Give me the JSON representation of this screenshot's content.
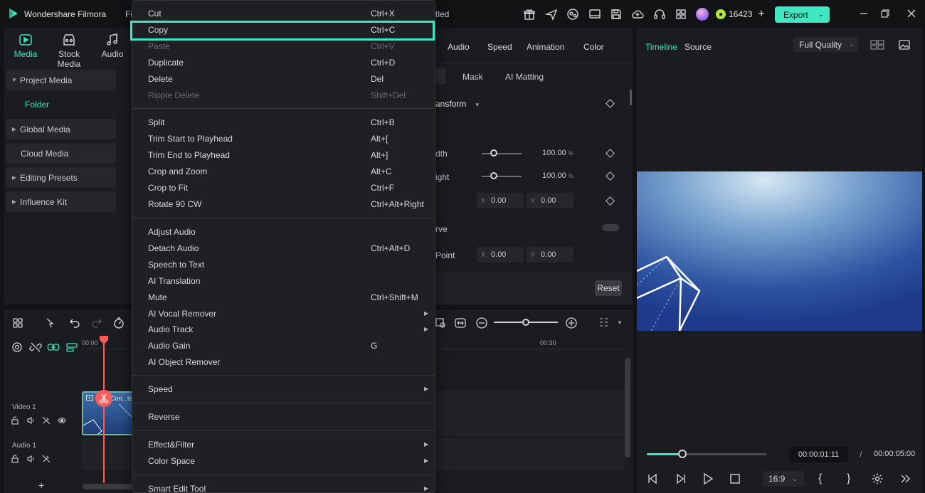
{
  "app": {
    "name": "Wondershare Filmora",
    "menu_partial": "Fi",
    "project_name_partial": "tled"
  },
  "colors": {
    "accent": "#3ee6c1",
    "playhead": "#ff5a5a",
    "background": "#121315",
    "panel": "#1b1c1f"
  },
  "titlebar": {
    "icons": [
      "gift-icon",
      "send-icon",
      "community-icon",
      "screen-icon",
      "save-icon",
      "cloud-upload-icon",
      "headset-icon",
      "apps-grid-icon"
    ],
    "credits": "16423",
    "export_label": "Export",
    "window_controls": [
      "minimize-icon",
      "restore-icon",
      "close-icon"
    ]
  },
  "media_panel": {
    "tabs": [
      {
        "label": "Media",
        "icon": "media-icon",
        "active": true
      },
      {
        "label": "Stock Media",
        "icon": "stock-media-icon",
        "active": false
      },
      {
        "label": "Audio",
        "icon": "music-note-icon",
        "active": false
      }
    ],
    "nav": [
      {
        "label": "Project Media",
        "expanded": true
      },
      {
        "label": "Folder",
        "child": true
      },
      {
        "label": "Global Media",
        "expanded": false
      },
      {
        "label": "Cloud Media"
      },
      {
        "label": "Editing Presets",
        "expanded": false
      },
      {
        "label": "Influence Kit",
        "expanded": false
      }
    ]
  },
  "props_panel": {
    "tabs": [
      "Audio",
      "Speed",
      "Animation",
      "Color"
    ],
    "subtabs": [
      "Mask",
      "AI Matting"
    ],
    "section": "ansform",
    "rows": {
      "width": {
        "label": "dth",
        "value": "100.00",
        "unit": "%",
        "fraction": 0.3
      },
      "height": {
        "label": "ight",
        "value": "100.00",
        "unit": "%",
        "fraction": 0.3
      },
      "position": {
        "x_label": "X",
        "x": "0.00",
        "y_label": "Y",
        "y": "0.00"
      },
      "curve": {
        "label": "rve"
      },
      "anchor": {
        "label": "Point",
        "x_label": "X",
        "x": "0.00",
        "y_label": "Y",
        "y": "0.00"
      }
    },
    "reset_label": "Reset"
  },
  "preview": {
    "tabs": [
      {
        "label": "Timeline",
        "active": true
      },
      {
        "label": "Source",
        "active": false
      }
    ],
    "quality": "Full Quality",
    "progress": 0.3,
    "current_time": "00:00:01:11",
    "separator": "/",
    "total_time": "00:00:05:00",
    "aspect_ratio": "16:9"
  },
  "timeline": {
    "ruler": [
      "00:00",
      "00:30"
    ],
    "tracks": [
      {
        "name": "Video 1"
      },
      {
        "name": "Audio 1"
      }
    ],
    "clip_title": "Con...te",
    "add_track": "+"
  },
  "context_menu": {
    "groups": [
      [
        {
          "label": "Cut",
          "shortcut": "Ctrl+X"
        },
        {
          "label": "Copy",
          "shortcut": "Ctrl+C",
          "highlighted": true
        },
        {
          "label": "Paste",
          "shortcut": "Ctrl+V",
          "disabled": true
        },
        {
          "label": "Duplicate",
          "shortcut": "Ctrl+D"
        },
        {
          "label": "Delete",
          "shortcut": "Del"
        },
        {
          "label": "Ripple Delete",
          "shortcut": "Shift+Del",
          "disabled": true
        }
      ],
      [
        {
          "label": "Split",
          "shortcut": "Ctrl+B"
        },
        {
          "label": "Trim Start to Playhead",
          "shortcut": "Alt+["
        },
        {
          "label": "Trim End to Playhead",
          "shortcut": "Alt+]"
        },
        {
          "label": "Crop and Zoom",
          "shortcut": "Alt+C"
        },
        {
          "label": "Crop to Fit",
          "shortcut": "Ctrl+F"
        },
        {
          "label": "Rotate 90 CW",
          "shortcut": "Ctrl+Alt+Right"
        }
      ],
      [
        {
          "label": "Adjust Audio",
          "shortcut": ""
        },
        {
          "label": "Detach Audio",
          "shortcut": "Ctrl+Alt+D"
        },
        {
          "label": "Speech to Text",
          "shortcut": ""
        },
        {
          "label": "AI Translation",
          "shortcut": ""
        },
        {
          "label": "Mute",
          "shortcut": "Ctrl+Shift+M"
        },
        {
          "label": "AI Vocal Remover",
          "shortcut": "",
          "submenu": true
        },
        {
          "label": "Audio Track",
          "shortcut": "",
          "submenu": true
        },
        {
          "label": "Audio Gain",
          "shortcut": "G"
        },
        {
          "label": "AI Object Remover",
          "shortcut": ""
        }
      ],
      [
        {
          "label": "Speed",
          "shortcut": "",
          "submenu": true
        }
      ],
      [
        {
          "label": "Reverse",
          "shortcut": ""
        }
      ],
      [
        {
          "label": "Effect&Filter",
          "shortcut": "",
          "submenu": true
        },
        {
          "label": "Color Space",
          "shortcut": "",
          "submenu": true
        }
      ],
      [
        {
          "label": "Smart Edit Tool",
          "shortcut": "",
          "submenu": true
        }
      ]
    ]
  }
}
